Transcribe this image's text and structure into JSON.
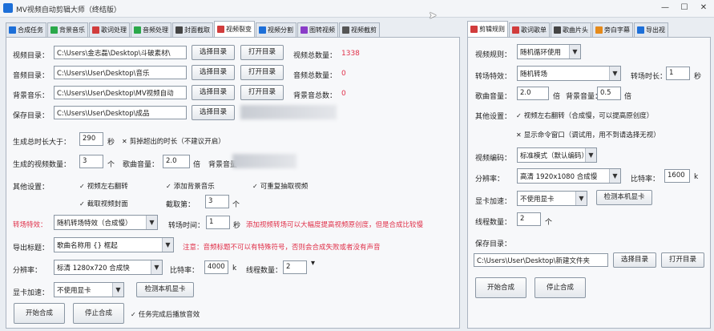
{
  "window": {
    "title": "MV视频自动剪辑大师（终结版）",
    "minimize": "—",
    "maximize": "☐",
    "close": "✕"
  },
  "left_tabs": [
    {
      "label": "合成任务",
      "icon_color": "#1d6fd8"
    },
    {
      "label": "背景音乐",
      "icon_color": "#2aa84a"
    },
    {
      "label": "歌词处理",
      "icon_color": "#d13c3c"
    },
    {
      "label": "音频处理",
      "icon_color": "#2aa84a"
    },
    {
      "label": "封面截取",
      "icon_color": "#444444"
    },
    {
      "label": "视频裂变",
      "icon_color": "#d13c3c"
    },
    {
      "label": "视频分割",
      "icon_color": "#1d6fd8"
    },
    {
      "label": "图转视频",
      "icon_color": "#8a3cc8"
    },
    {
      "label": "视频截剪",
      "icon_color": "#555555"
    }
  ],
  "right_tabs": [
    {
      "label": "剪辑规则",
      "icon_color": "#d13c3c"
    },
    {
      "label": "歌词歌单",
      "icon_color": "#d13c3c"
    },
    {
      "label": "歌曲片头",
      "icon_color": "#444444"
    },
    {
      "label": "旁白字幕",
      "icon_color": "#e58a1a"
    },
    {
      "label": "导出视",
      "icon_color": "#1d6fd8"
    }
  ],
  "left": {
    "video_dir": {
      "label": "视频目录：",
      "value": "C:\\Users\\金志磊\\Desktop\\斗破素材\\"
    },
    "audio_dir": {
      "label": "音频目录：",
      "value": "C:\\Users\\User\\Desktop\\音乐"
    },
    "bgm_dir": {
      "label": "背景音乐：",
      "value": "C:\\Users\\User\\Desktop\\MV视频自动"
    },
    "save_dir": {
      "label": "保存目录：",
      "value": "C:\\Users\\User\\Desktop\\成品"
    },
    "select_dir": "选择目录",
    "open_dir": "打开目录",
    "video_total_label": "视频总数量：",
    "video_total": "1338",
    "audio_total_label": "音频总数量：",
    "audio_total": "0",
    "bgm_total_label": "背景音总数：",
    "bgm_total": "0",
    "min_duration": {
      "label": "生成总时长大于：",
      "value": "290",
      "unit": "秒",
      "check": "剪掉超出的时长（不建议开启）"
    },
    "video_count": {
      "label": "生成的视频数量：",
      "value": "3",
      "unit": "个"
    },
    "song_volume": {
      "label": "歌曲音量：",
      "value": "2.0",
      "unit": "倍"
    },
    "bg_volume_label": "背景音量",
    "other_label": "其他设置：",
    "checks": [
      "视频左右翻转",
      "添加背景音乐",
      "可重复抽取视频",
      "截取视频封面"
    ],
    "cover_count": {
      "label": "截取第：",
      "value": "3",
      "unit": "个"
    },
    "transition": {
      "label": "转场特效：",
      "value": "随机转场特效（合成慢）"
    },
    "transition_time": {
      "label": "转场时间：",
      "value": "1",
      "unit": "秒"
    },
    "transition_note": "添加视频转场可以大幅度提高视频原创度，但是合成比较慢",
    "export_title": {
      "label": "导出标题：",
      "value": "歌曲名称用 {} 框起"
    },
    "export_note": "注意：音频标题不可以有特殊符号，否则会合成失败或者没有声音",
    "resolution": {
      "label": "分辨率：",
      "value": "标清 1280x720  合成快"
    },
    "bitrate": {
      "label": "比特率：",
      "value": "4000",
      "unit": "k"
    },
    "threads": {
      "label": "线程数量：",
      "value": "2"
    },
    "gpu": {
      "label": "显卡加速：",
      "value": "不使用显卡",
      "detect": "检测本机显卡"
    },
    "start": "开始合成",
    "stop": "停止合成",
    "finish_check": "任务完成后播放音效"
  },
  "right": {
    "rule": {
      "label": "视频规则：",
      "value": "随机循环使用"
    },
    "transition": {
      "label": "转场特效：",
      "value": "随机转场"
    },
    "transition_time": {
      "label": "转场时长：",
      "value": "1",
      "unit": "秒"
    },
    "song_volume": {
      "label": "歌曲音量：",
      "value": "2.0",
      "unit": "倍"
    },
    "bg_volume": {
      "label": "背景音量：",
      "value": "0.5",
      "unit": "倍"
    },
    "other_label": "其他设置：",
    "check1": "视频左右翻转（合成慢，可以提高原创度）",
    "check2": "显示命令窗口（调试用，用不到请选择无视）",
    "encode": {
      "label": "视频编码：",
      "value": "标准模式（默认编码）"
    },
    "resolution": {
      "label": "分辨率：",
      "value": "高清 1920x1080 合成慢"
    },
    "bitrate": {
      "label": "比特率：",
      "value": "1600",
      "unit": "k"
    },
    "gpu": {
      "label": "显卡加速：",
      "value": "不使用显卡",
      "detect": "检测本机显卡"
    },
    "threads": {
      "label": "线程数量：",
      "value": "2",
      "unit": "个"
    },
    "save_label": "保存目录：",
    "save_value": "C:\\Users\\User\\Desktop\\新建文件夹",
    "select_dir": "选择目录",
    "open_dir": "打开目录",
    "start": "开始合成",
    "stop": "停止合成"
  }
}
